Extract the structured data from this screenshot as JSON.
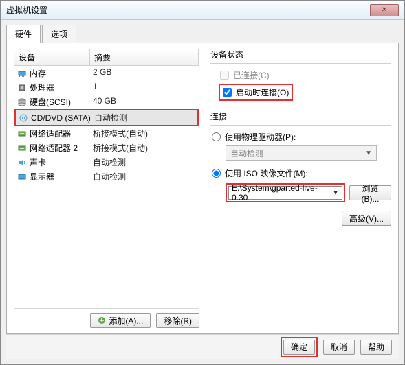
{
  "window": {
    "title": "虚拟机设置"
  },
  "tabs": [
    "硬件",
    "选项"
  ],
  "device_table": {
    "headers": [
      "设备",
      "摘要"
    ],
    "rows": [
      {
        "icon": "memory-icon",
        "name": "内存",
        "summary": "2 GB",
        "selected": false,
        "summary_red": false
      },
      {
        "icon": "cpu-icon",
        "name": "处理器",
        "summary": "1",
        "selected": false,
        "summary_red": true
      },
      {
        "icon": "disk-icon",
        "name": "硬盘(SCSI)",
        "summary": "40 GB",
        "selected": false,
        "summary_red": false
      },
      {
        "icon": "cd-icon",
        "name": "CD/DVD (SATA)",
        "summary": "自动检测",
        "selected": true,
        "summary_red": false,
        "highlight": true
      },
      {
        "icon": "nic-icon",
        "name": "网络适配器",
        "summary": "桥接模式(自动)",
        "selected": false,
        "summary_red": false
      },
      {
        "icon": "nic-icon",
        "name": "网络适配器 2",
        "summary": "桥接模式(自动)",
        "selected": false,
        "summary_red": false
      },
      {
        "icon": "sound-icon",
        "name": "声卡",
        "summary": "自动检测",
        "selected": false,
        "summary_red": false
      },
      {
        "icon": "display-icon",
        "name": "显示器",
        "summary": "自动检测",
        "selected": false,
        "summary_red": false
      }
    ]
  },
  "left_buttons": {
    "add": "添加(A)...",
    "remove": "移除(R)"
  },
  "right": {
    "status": {
      "title": "设备状态",
      "connected": "已连接(C)",
      "connect_at_poweron": "启动时连接(O)"
    },
    "connection": {
      "title": "连接",
      "physical": "使用物理驱动器(P):",
      "physical_combo": "自动检测",
      "iso": "使用 ISO 映像文件(M):",
      "iso_path": "E:\\System\\gparted-live-0.30",
      "browse": "浏览(B)...",
      "advanced": "高级(V)..."
    }
  },
  "footer": {
    "ok": "确定",
    "cancel": "取消",
    "help": "帮助"
  },
  "icons_svg": {
    "memory-icon": "<rect x='2' y='4' width='10' height='6' fill='#4aa3df' stroke='#2a6fa0'/><rect x='3' y='10' width='1' height='2' fill='#888'/><rect x='5' y='10' width='1' height='2' fill='#888'/><rect x='7' y='10' width='1' height='2' fill='#888'/><rect x='9' y='10' width='1' height='2' fill='#888'/>",
    "cpu-icon": "<rect x='3' y='3' width='8' height='8' fill='#888' stroke='#555'/><rect x='5' y='5' width='4' height='4' fill='#ccc'/>",
    "disk-icon": "<ellipse cx='7' cy='4' rx='5' ry='2' fill='#bbb' stroke='#777'/><rect x='2' y='4' width='10' height='6' fill='#bbb' stroke='#777'/><ellipse cx='7' cy='10' rx='5' ry='2' fill='#ddd' stroke='#777'/>",
    "cd-icon": "<circle cx='7' cy='7' r='5' fill='#cde6f7' stroke='#5aa0d8'/><circle cx='7' cy='7' r='1.5' fill='#fff' stroke='#5aa0d8'/>",
    "nic-icon": "<rect x='2' y='4' width='10' height='6' fill='#6ab04c' stroke='#3d7a2f'/><rect x='4' y='6' width='6' height='2' fill='#cfe8c4'/>",
    "sound-icon": "<path d='M3 5h3l3-3v10l-3-3H3z' fill='#4aa3df'/><path d='M10 5c1 1 1 3 0 4' stroke='#4aa3df' fill='none'/>",
    "display-icon": "<rect x='2' y='3' width='10' height='7' fill='#4aa3df' stroke='#2a6fa0'/><rect x='5' y='11' width='4' height='1' fill='#888'/>"
  },
  "colors": {
    "highlight_red": "#e03030"
  }
}
